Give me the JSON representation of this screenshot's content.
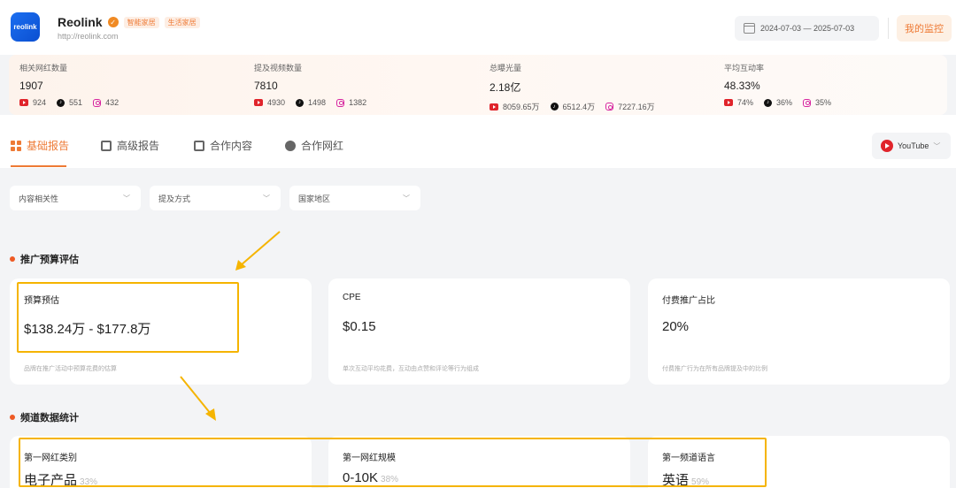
{
  "header": {
    "logo_text": "reolink",
    "brand_name": "Reolink",
    "tags": [
      "智能家居",
      "生活家居"
    ],
    "url": "http://reolink.com",
    "date_range": "2024-07-03 — 2025-07-03",
    "monitor_button": "我的监控"
  },
  "stats": [
    {
      "label": "相关网红数量",
      "value": "1907",
      "youtube": "924",
      "tiktok": "551",
      "instagram": "432"
    },
    {
      "label": "提及视频数量",
      "value": "7810",
      "youtube": "4930",
      "tiktok": "1498",
      "instagram": "1382"
    },
    {
      "label": "总曝光量",
      "value": "2.18亿",
      "youtube": "8059.65万",
      "tiktok": "6512.4万",
      "instagram": "7227.16万"
    },
    {
      "label": "平均互动率",
      "value": "48.33%",
      "youtube": "74%",
      "tiktok": "36%",
      "instagram": "35%"
    }
  ],
  "tabs": [
    "基础报告",
    "高级报告",
    "合作内容",
    "合作网红"
  ],
  "platform_select": "YouTube",
  "filters": [
    "内容相关性",
    "提及方式",
    "国家地区"
  ],
  "section_budget": {
    "title": "推广预算评估",
    "cards": [
      {
        "label": "预算预估",
        "value": "$138.24万 - $177.8万",
        "desc": "品牌在推广活动中预算花费的估算"
      },
      {
        "label": "CPE",
        "value": "$0.15",
        "desc": "单次互动平均花费，互动由点赞和评论等行为组成"
      },
      {
        "label": "付费推广占比",
        "value": "20%",
        "desc": "付费推广行为在所有品牌提及中的比例"
      }
    ]
  },
  "section_channel": {
    "title": "频道数据统计",
    "cards": [
      {
        "label": "第一网红类别",
        "value": "电子产品",
        "pct": "33%"
      },
      {
        "label": "第一网红规模",
        "value": "0-10K",
        "pct": "38%"
      },
      {
        "label": "第一频道语言",
        "value": "英语",
        "pct": "59%"
      }
    ]
  },
  "colors": {
    "accent": "#ee7a35",
    "highlight": "#f5b400",
    "youtube": "#e0242b"
  }
}
